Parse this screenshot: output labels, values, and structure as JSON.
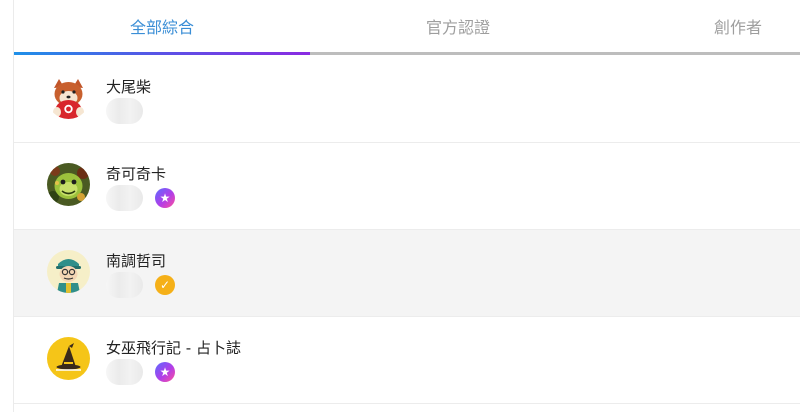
{
  "tabs": [
    {
      "label": "全部綜合",
      "active": true
    },
    {
      "label": "官方認證",
      "active": false
    },
    {
      "label": "創作者",
      "active": false
    }
  ],
  "colors": {
    "active_tab_text": "#3a8ed6",
    "inactive_tab_text": "#9e9e9e",
    "underline_gradient": [
      "#1e90e8",
      "#8a2be2"
    ],
    "hover_row": "#f4f4f4",
    "star_badge": [
      "#5b6bff",
      "#b23ee8",
      "#ff4f9a"
    ],
    "check_badge": "#f5b018"
  },
  "results": [
    {
      "name": "大尾柴",
      "avatar": "shiba-avatar",
      "badge": null
    },
    {
      "name": "奇可奇卡",
      "avatar": "green-creature-avatar",
      "badge": "star-icon"
    },
    {
      "name": "南調哲司",
      "avatar": "cartoon-man-avatar",
      "badge": "check-icon",
      "hovered": true
    },
    {
      "name": "女巫飛行記 - 占卜誌",
      "avatar": "witch-hat-avatar",
      "badge": "star-icon"
    }
  ],
  "badge_glyphs": {
    "star": "★",
    "check": "✓"
  }
}
